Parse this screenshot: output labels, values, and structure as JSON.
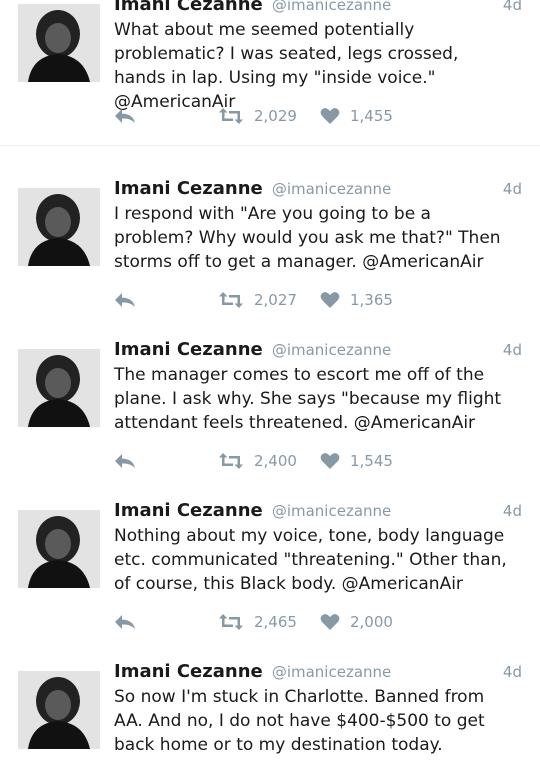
{
  "tweets": [
    {
      "name": "Imani Cezanne",
      "handle": "@imanicezanne",
      "time": "4d",
      "text": "What about me seemed potentially\nproblematic? I was seated, legs crossed,\nhands in lap. Using my \"inside voice.\"\n@AmericanAir",
      "retweets": "2,029",
      "likes": "1,455"
    },
    {
      "name": "Imani Cezanne",
      "handle": "@imanicezanne",
      "time": "4d",
      "text": "I respond with \"Are you going to be a\nproblem? Why would you ask me that?\" Then\nstorms off to get a manager. @AmericanAir",
      "retweets": "2,027",
      "likes": "1,365"
    },
    {
      "name": "Imani Cezanne",
      "handle": "@imanicezanne",
      "time": "4d",
      "text": "The manager comes to escort me off of the\nplane. I ask why. She says \"because my flight\nattendant feels threatened. @AmericanAir",
      "retweets": "2,400",
      "likes": "1,545"
    },
    {
      "name": "Imani Cezanne",
      "handle": "@imanicezanne",
      "time": "4d",
      "text": "Nothing about my voice, tone, body language\netc. communicated \"threatening.\" Other than,\nof course, this Black body. @AmericanAir",
      "retweets": "2,465",
      "likes": "2,000"
    },
    {
      "name": "Imani Cezanne",
      "handle": "@imanicezanne",
      "time": "4d",
      "text": "So now I'm stuck in Charlotte. Banned from\nAA. And no, I do not have $400-$500 to get\nback home or to my destination today.",
      "retweets": "",
      "likes": ""
    }
  ],
  "colors": {
    "meta": "#8899a6",
    "text": "#1a1a1a",
    "divider": "#e6ecf0"
  },
  "icons": {
    "reply": "reply-icon",
    "retweet": "retweet-icon",
    "like": "heart-icon"
  }
}
